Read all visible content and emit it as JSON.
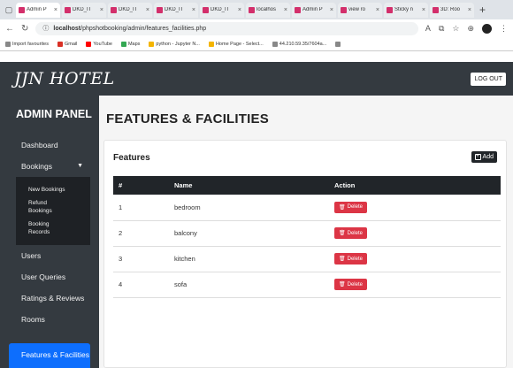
{
  "browser": {
    "tabs": [
      {
        "label": "Admin P",
        "active": true
      },
      {
        "label": "DKD_IT",
        "active": false
      },
      {
        "label": "DKD_IT",
        "active": false
      },
      {
        "label": "DKD_IT",
        "active": false
      },
      {
        "label": "DKD_IT",
        "active": false
      },
      {
        "label": "localhos",
        "active": false
      },
      {
        "label": "Admin P",
        "active": false
      },
      {
        "label": "view ro",
        "active": false
      },
      {
        "label": "Sticky n",
        "active": false
      },
      {
        "label": "3D: Roo",
        "active": false
      }
    ],
    "url_host": "localhost",
    "url_path": "/phpshotbooking/admin/features_facilities.php",
    "bookmarks": [
      "Import favourites",
      "Gmail",
      "YouTube",
      "Maps",
      "python - Jupyter N...",
      "Home Page - Select...",
      "44.210.59.35/7604a..."
    ]
  },
  "header": {
    "brand": "JJN HOTEL",
    "logout_label": "LOG OUT"
  },
  "sidebar": {
    "title": "ADMIN PANEL",
    "dashboard": "Dashboard",
    "bookings": "Bookings",
    "booking_sub": [
      "New Bookings",
      "Refund Bookings",
      "Booking Records"
    ],
    "items": [
      "Users",
      "User Queries",
      "Ratings & Reviews",
      "Rooms"
    ],
    "active": "Features & Facilities"
  },
  "main": {
    "page_title": "FEATURES & FACILITIES",
    "card_title": "Features",
    "add_label": "Add",
    "columns": [
      "#",
      "Name",
      "Action"
    ],
    "rows": [
      {
        "num": "1",
        "name": "bedroom",
        "action": "Delete"
      },
      {
        "num": "2",
        "name": "balcony",
        "action": "Delete"
      },
      {
        "num": "3",
        "name": "kitchen",
        "action": "Delete"
      },
      {
        "num": "4",
        "name": "sofa",
        "action": "Delete"
      }
    ]
  }
}
